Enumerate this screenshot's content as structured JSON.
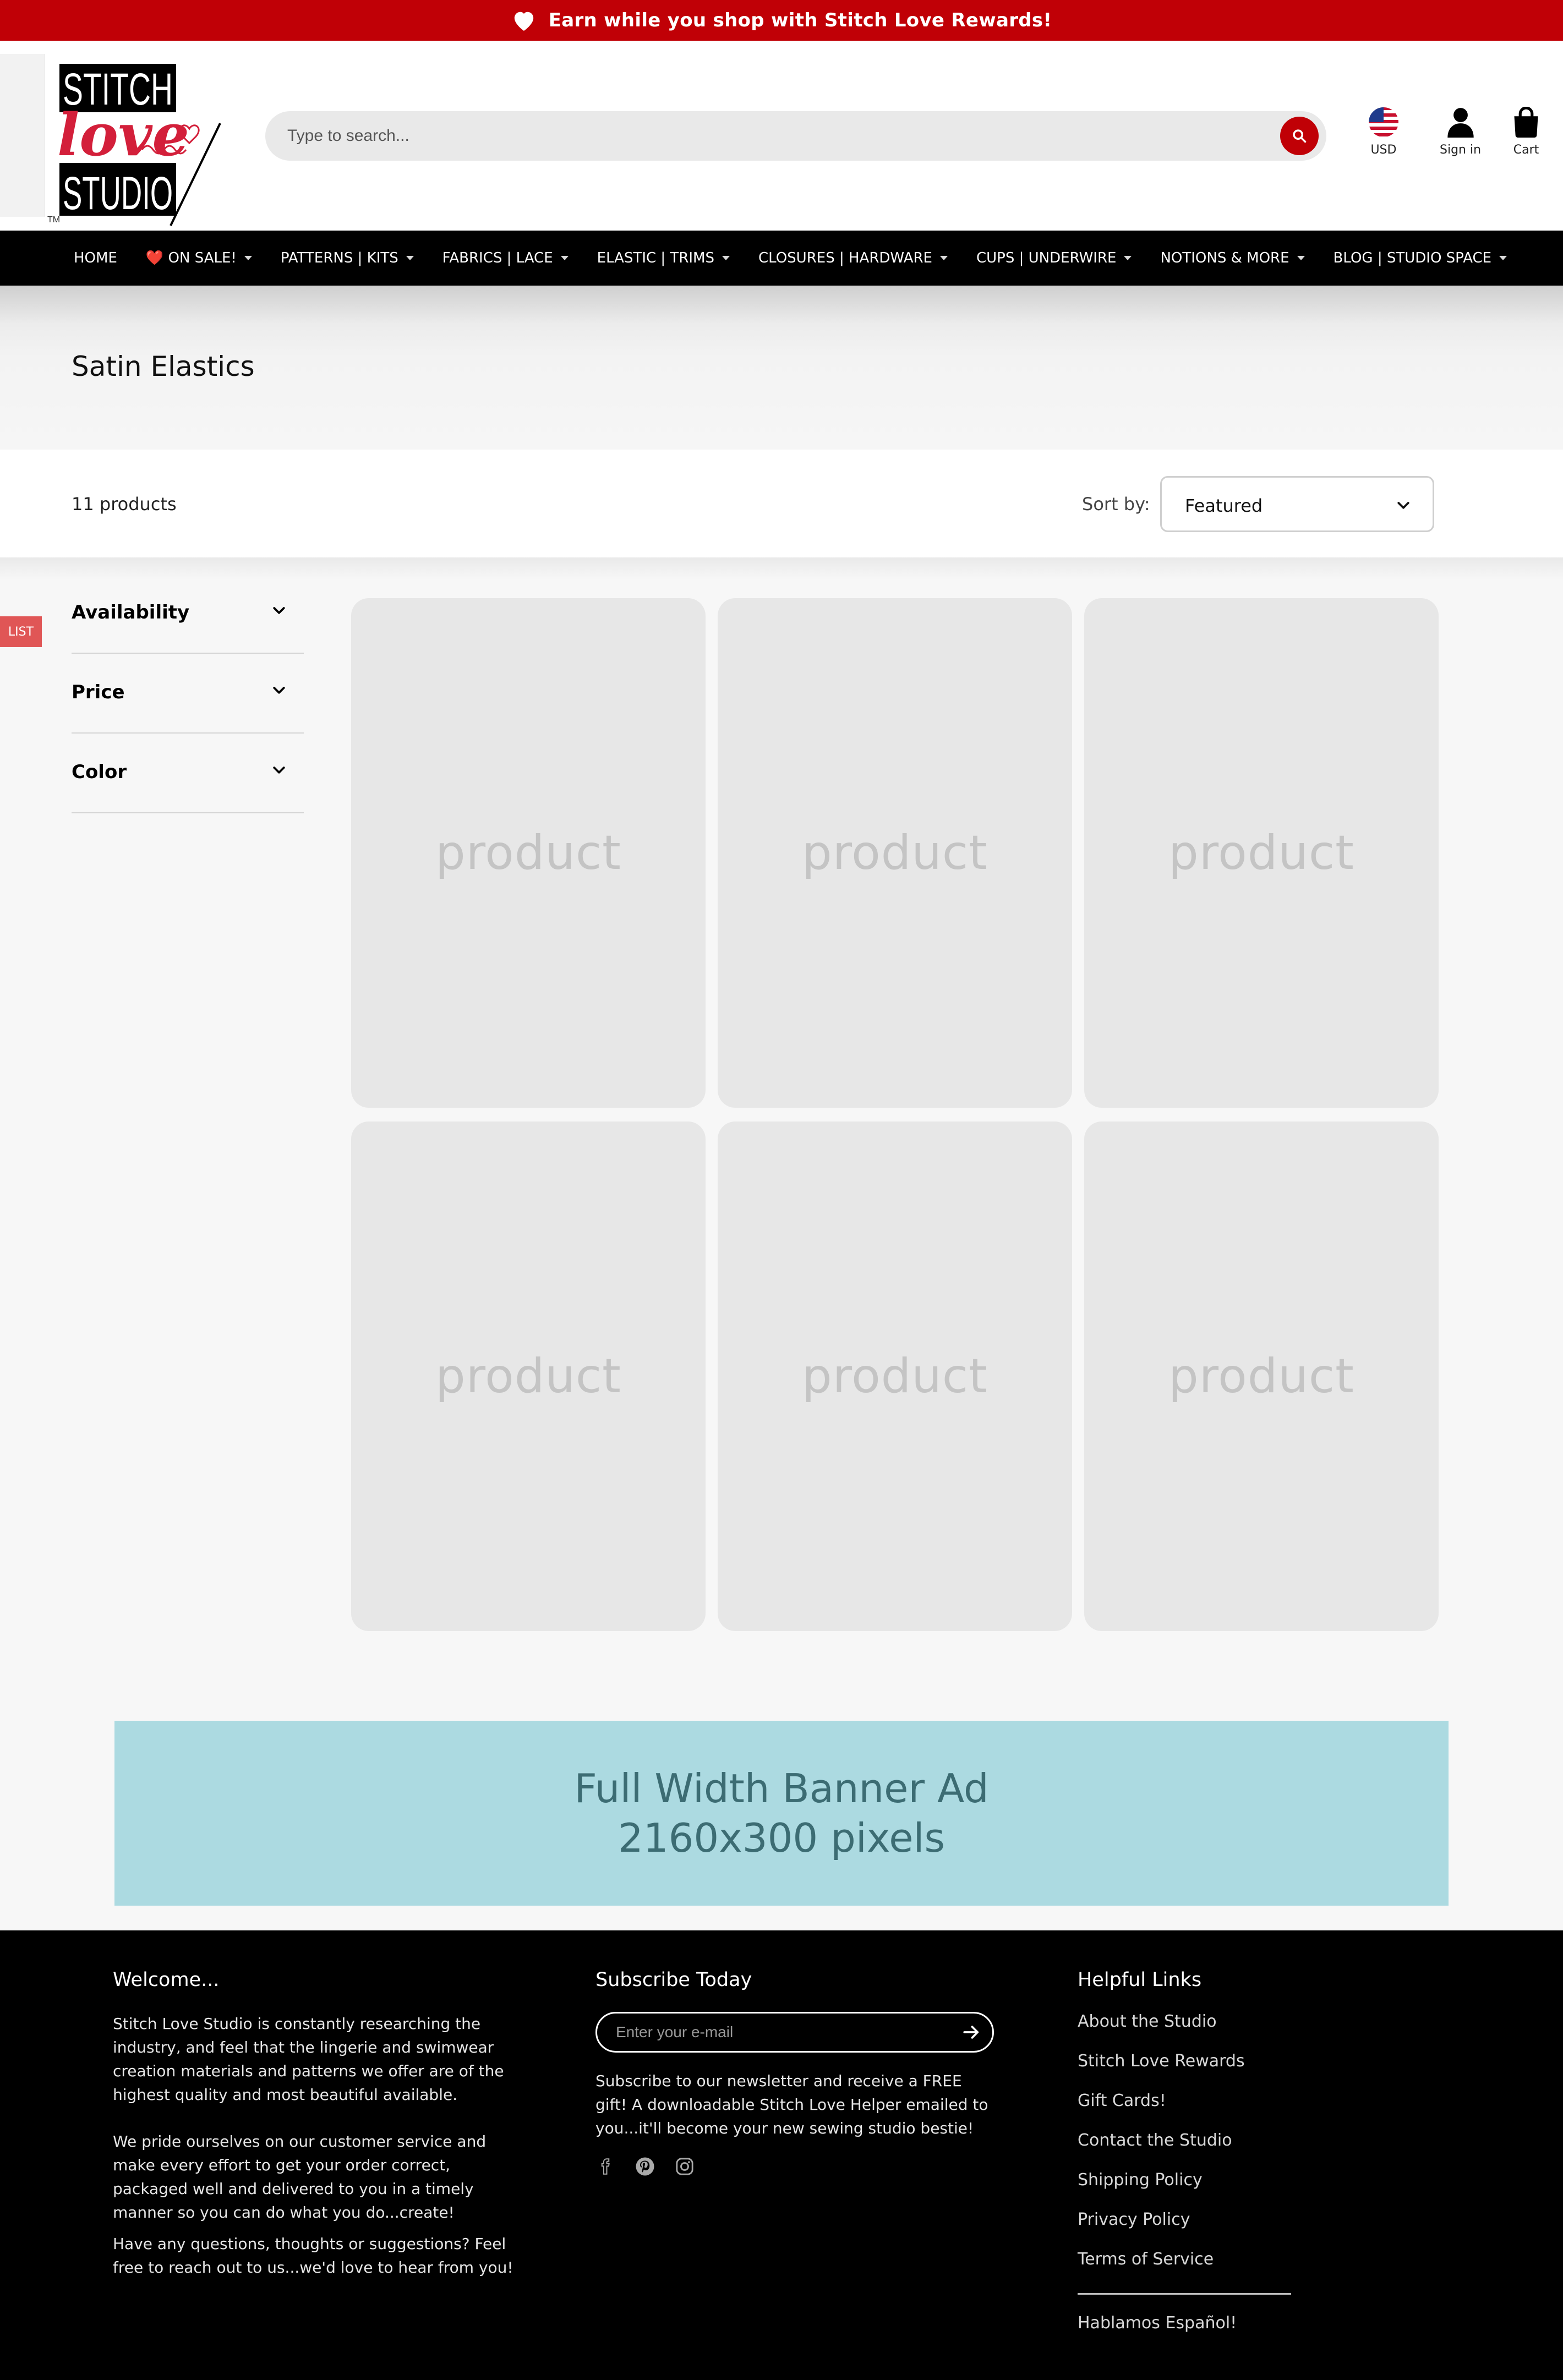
{
  "announcement": {
    "text": "Earn while you shop with Stitch Love Rewards!"
  },
  "brand": {
    "logo_line1": "STITCH",
    "logo_line2": "love",
    "logo_line3": "STUDIO",
    "trademark": "TM",
    "accent": "#c00006"
  },
  "search": {
    "placeholder": "Type to search..."
  },
  "header_icons": {
    "currency": "USD",
    "sign_in": "Sign in",
    "cart": "Cart"
  },
  "nav": {
    "items": [
      {
        "label": "HOME"
      },
      {
        "label": "❤️ ON SALE!"
      },
      {
        "label": "PATTERNS | KITS"
      },
      {
        "label": "FABRICS | LACE"
      },
      {
        "label": "ELASTIC | TRIMS"
      },
      {
        "label": "CLOSURES | HARDWARE"
      },
      {
        "label": "CUPS | UNDERWIRE"
      },
      {
        "label": "NOTIONS & MORE"
      },
      {
        "label": "BLOG | STUDIO SPACE"
      }
    ]
  },
  "collection": {
    "title": "Satin Elastics",
    "count": "11 products"
  },
  "sort": {
    "label": "Sort by:",
    "selected": "Featured"
  },
  "side_tab": {
    "label": "LIST"
  },
  "filters": [
    {
      "label": "Availability"
    },
    {
      "label": "Price"
    },
    {
      "label": "Color"
    }
  ],
  "products": [
    {
      "placeholder": "product"
    },
    {
      "placeholder": "product"
    },
    {
      "placeholder": "product"
    },
    {
      "placeholder": "product"
    },
    {
      "placeholder": "product"
    },
    {
      "placeholder": "product"
    }
  ],
  "banner": {
    "line1": "Full Width Banner Ad",
    "line2": "2160x300 pixels"
  },
  "footer": {
    "welcome": {
      "heading": "Welcome...",
      "p1": "Stitch Love Studio is constantly researching the industry, and feel that the lingerie and swimwear creation materials and patterns we offer are of the highest quality and most beautiful available.",
      "p2": "We pride ourselves on our customer service and make every effort to get your order correct, packaged well and delivered to you in a timely manner so you can do what you do...create!",
      "p3": "Have any questions, thoughts or suggestions? Feel free to reach out to us...we'd love to hear from you!"
    },
    "subscribe": {
      "heading": "Subscribe Today",
      "email_placeholder": "Enter your e-mail",
      "text": "Subscribe to our newsletter and receive a FREE gift! A downloadable Stitch Love Helper emailed to you...it'll become your new sewing studio bestie!"
    },
    "helpful": {
      "heading": "Helpful Links",
      "links": [
        {
          "label": "About the Studio"
        },
        {
          "label": "Stitch Love Rewards"
        },
        {
          "label": "Gift Cards!"
        },
        {
          "label": "Contact the Studio"
        },
        {
          "label": "Shipping Policy"
        },
        {
          "label": "Privacy Policy"
        },
        {
          "label": "Terms of Service"
        }
      ],
      "spanish": "Hablamos Español!"
    }
  }
}
